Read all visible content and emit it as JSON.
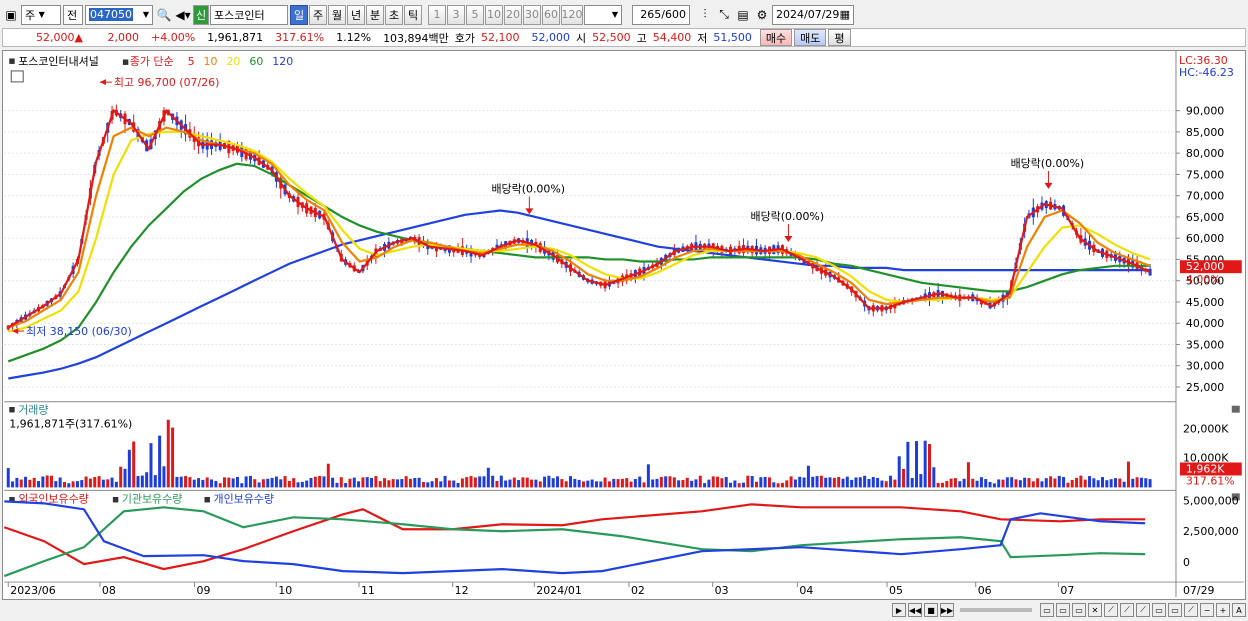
{
  "toolbar": {
    "period_main": "주",
    "prev_label": "전",
    "stock_code": "047050",
    "badge": "신",
    "stock_name": "포스코인터",
    "periods": [
      "일",
      "주",
      "월",
      "년",
      "분",
      "초",
      "틱"
    ],
    "active_period": "일",
    "intervals": [
      "1",
      "3",
      "5",
      "10",
      "20",
      "30",
      "60",
      "120"
    ],
    "count": "265",
    "count_total": "/600",
    "date": "2024/07/29"
  },
  "quote": {
    "price": "52,000",
    "change": "2,000",
    "change_pct": "+4.00%",
    "volume": "1,961,871",
    "vol_ratio": "317.61%",
    "turnover": "1.12%",
    "amount": "103,894백만",
    "bid_label": "호가",
    "bid": "52,100",
    "ask": "52,000",
    "open_label": "시",
    "open": "52,500",
    "high_label": "고",
    "high": "54,400",
    "low_label": "저",
    "low": "51,500",
    "buy_label": "매수",
    "sell_label": "매도",
    "eval_label": "평"
  },
  "chart_data": {
    "type": "line",
    "price_panel": {
      "stock_title": "포스코인터내셔널",
      "ma_label": "종가 단순",
      "ma_periods": [
        {
          "name": "5",
          "color": "#e01818"
        },
        {
          "name": "10",
          "color": "#f08000"
        },
        {
          "name": "20",
          "color": "#f0e000"
        },
        {
          "name": "60",
          "color": "#20902a"
        },
        {
          "name": "120",
          "color": "#2040e0"
        }
      ],
      "y_ticks": [
        "90,000",
        "85,000",
        "80,000",
        "75,000",
        "70,000",
        "65,000",
        "60,000",
        "55,000",
        "50,000",
        "45,000",
        "40,000",
        "35,000",
        "30,000",
        "25,000"
      ],
      "ylim": [
        22000,
        97000
      ],
      "lc": "LC:36.30",
      "hc": "HC:-46.23",
      "last_price_tag": "52,000",
      "last_pct_tag": "4.00%",
      "annotations": [
        {
          "text": "최고 96,700 (07/26)",
          "x": "2023-07-26",
          "y": 96700
        },
        {
          "text": "최저 38,150 (06/30)",
          "x": "2023-06-30",
          "y": 38150
        },
        {
          "text": "배당락(0.00%)",
          "x": "2023-12-27",
          "y": 67000
        },
        {
          "text": "배당락(0.00%)",
          "x": "2024-03-28",
          "y": 60500
        },
        {
          "text": "배당락(0.00%)",
          "x": "2024-06-27",
          "y": 73000
        }
      ],
      "series": [
        {
          "name": "5",
          "color": "#e01818",
          "values": [
            39000,
            41500,
            44000,
            47000,
            55000,
            78000,
            90000,
            87000,
            81000,
            90000,
            86000,
            82000,
            82000,
            81000,
            79000,
            76000,
            70000,
            67000,
            65000,
            55000,
            52000,
            57000,
            59000,
            60000,
            58000,
            57500,
            57000,
            56000,
            58000,
            59500,
            58500,
            56000,
            53000,
            50000,
            49000,
            50500,
            52000,
            54000,
            57000,
            58000,
            58000,
            57000,
            57500,
            57000,
            57500,
            55500,
            53000,
            51000,
            48000,
            43500,
            43500,
            45000,
            46000,
            47000,
            46000,
            46000,
            44000,
            47000,
            65000,
            68000,
            67000,
            60000,
            57000,
            55500,
            54000,
            52000
          ]
        },
        {
          "name": "10",
          "color": "#f08000",
          "values": [
            39000,
            40500,
            43000,
            45500,
            52000,
            70000,
            84000,
            86000,
            84000,
            86000,
            85000,
            83000,
            82000,
            81000,
            80000,
            77500,
            72500,
            69000,
            66500,
            59000,
            54500,
            55500,
            58000,
            59500,
            59000,
            58000,
            57000,
            56500,
            57500,
            58500,
            58500,
            57000,
            54500,
            51500,
            50000,
            50000,
            51000,
            53000,
            55500,
            57000,
            57500,
            57000,
            57000,
            57000,
            57000,
            56000,
            54000,
            52000,
            49500,
            45500,
            44500,
            45000,
            45500,
            46000,
            46000,
            46000,
            45000,
            46000,
            58000,
            65000,
            66500,
            63500,
            59000,
            56500,
            55000,
            53500
          ]
        },
        {
          "name": "20",
          "color": "#f0e000",
          "values": [
            38000,
            39000,
            41000,
            43000,
            47500,
            60000,
            75000,
            83000,
            84500,
            85000,
            85000,
            84000,
            83000,
            82000,
            80500,
            78000,
            74000,
            70500,
            67500,
            62000,
            57500,
            56000,
            57000,
            58000,
            58500,
            58000,
            57500,
            57000,
            57000,
            57500,
            58000,
            57500,
            56000,
            53500,
            51500,
            50500,
            50500,
            52000,
            54000,
            56000,
            57000,
            57000,
            57000,
            57000,
            57000,
            56500,
            55500,
            53500,
            51000,
            47500,
            45500,
            45000,
            45500,
            45500,
            46000,
            46000,
            45500,
            46000,
            52000,
            58000,
            62500,
            63000,
            61000,
            58500,
            56500,
            55000
          ]
        },
        {
          "name": "60",
          "color": "#20902a",
          "values": [
            31000,
            32500,
            34000,
            36000,
            39000,
            45000,
            52000,
            58000,
            63000,
            67000,
            71000,
            74000,
            76000,
            77500,
            77000,
            75000,
            72500,
            70000,
            67500,
            65000,
            63000,
            61500,
            60500,
            59500,
            58500,
            58000,
            57500,
            57000,
            56500,
            56000,
            55500,
            55500,
            55500,
            55500,
            55000,
            55000,
            54500,
            54500,
            55000,
            55000,
            55500,
            55500,
            55500,
            55500,
            55500,
            55500,
            55000,
            54000,
            53500,
            52500,
            51500,
            50500,
            49500,
            49000,
            48500,
            48000,
            47500,
            47500,
            48500,
            50000,
            51500,
            52500,
            53000,
            53500,
            53500,
            53500
          ]
        },
        {
          "name": "120",
          "color": "#2040e0",
          "values": [
            27000,
            27700,
            28400,
            29300,
            30500,
            32000,
            34000,
            36000,
            38000,
            40000,
            42000,
            44000,
            46000,
            48000,
            50000,
            52000,
            54000,
            55500,
            57000,
            58500,
            59500,
            60500,
            61500,
            62500,
            63500,
            64500,
            65500,
            66000,
            66500,
            66000,
            65000,
            64000,
            63000,
            62000,
            61000,
            60000,
            59000,
            58000,
            57500,
            57000,
            56500,
            56000,
            55500,
            55000,
            54500,
            54000,
            53500,
            53500,
            53000,
            53000,
            53000,
            52500,
            52500,
            52500,
            52500,
            52500,
            52500,
            52500,
            52500,
            52500,
            52500,
            52500,
            52500,
            52500,
            52500,
            52500
          ]
        }
      ]
    },
    "volume_panel": {
      "title": "거래량",
      "info": "1,961,871주(317.61%)",
      "y_ticks": [
        "20,000K",
        "10,000K"
      ],
      "last_tag": "1,962K",
      "last_pct": "317.61%"
    },
    "holding_panel": {
      "legend": [
        {
          "name": "외국인보유수량",
          "color": "#e01818"
        },
        {
          "name": "기관보유수량",
          "color": "#2a9a5a"
        },
        {
          "name": "개인보유수량",
          "color": "#2040e0"
        }
      ],
      "y_ticks": [
        "5,000,000",
        "2,500,000",
        "0"
      ]
    },
    "x_ticks": [
      "2023/06",
      "08",
      "09",
      "10",
      "11",
      "12",
      "2024/01",
      "02",
      "03",
      "04",
      "05",
      "06",
      "07"
    ],
    "x_axis_right": "07/29"
  }
}
